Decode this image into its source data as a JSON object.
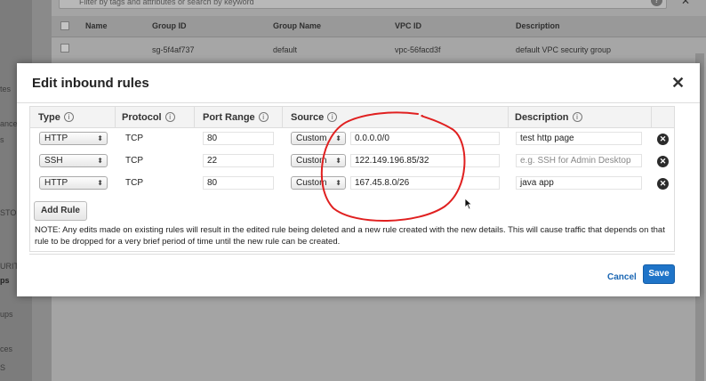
{
  "background": {
    "search_placeholder": "Filter by tags and attributes or search by keyword",
    "columns": [
      "Name",
      "Group ID",
      "Group Name",
      "VPC ID",
      "Description"
    ],
    "row": {
      "name": "",
      "group_id": "sg-5f4af737",
      "group_name": "default",
      "vpc_id": "vpc-56facd3f",
      "description": "default VPC security group"
    },
    "sidebar_labels": [
      "tes",
      "ances",
      "s",
      "STO",
      "URIT",
      "ps",
      "ups",
      "ces",
      "S"
    ]
  },
  "modal": {
    "title": "Edit inbound rules",
    "close_glyph": "✕",
    "headers": {
      "type": "Type",
      "protocol": "Protocol",
      "port_range": "Port Range",
      "source": "Source",
      "description": "Description"
    },
    "info_glyph": "i",
    "rules": [
      {
        "type": "HTTP",
        "protocol": "TCP",
        "port": "80",
        "source_type": "Custom",
        "source": "0.0.0.0/0",
        "description": "test http page",
        "description_placeholder": ""
      },
      {
        "type": "SSH",
        "protocol": "TCP",
        "port": "22",
        "source_type": "Custom",
        "source": "122.149.196.85/32",
        "description": "",
        "description_placeholder": "e.g. SSH for Admin Desktop"
      },
      {
        "type": "HTTP",
        "protocol": "TCP",
        "port": "80",
        "source_type": "Custom",
        "source": "167.45.8.0/26",
        "description": "java app",
        "description_placeholder": ""
      }
    ],
    "add_rule_label": "Add Rule",
    "note": "NOTE: Any edits made on existing rules will result in the edited rule being deleted and a new rule created with the new details. This will cause traffic that depends on that rule to be dropped for a very brief period of time until the new rule can be created.",
    "cancel_label": "Cancel",
    "save_label": "Save",
    "delete_glyph": "✕",
    "select_arrows": "⬍"
  },
  "colors": {
    "primary": "#1f74c8",
    "annotation": "#e02020",
    "link": "#1a66b3"
  },
  "icons": [
    "search-icon",
    "help-icon",
    "close-icon",
    "info-icon",
    "delete-icon",
    "cursor-icon"
  ]
}
